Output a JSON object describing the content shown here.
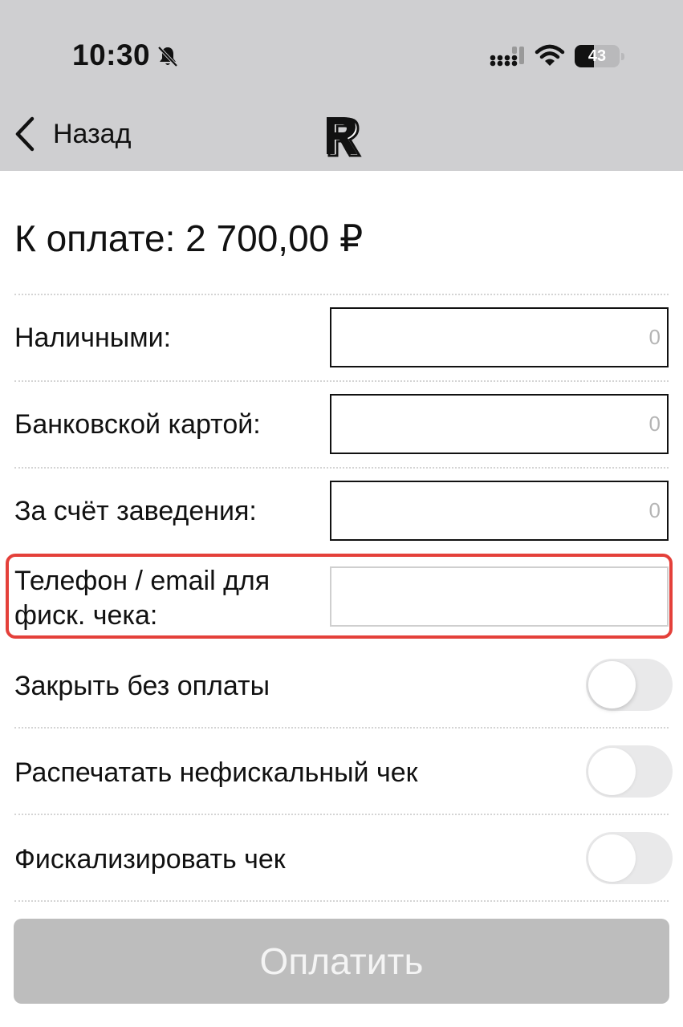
{
  "status_bar": {
    "time": "10:30",
    "battery": "43",
    "battery_level": 0.43,
    "icons": [
      "bell-muted-icon",
      "signal-icon",
      "wifi-icon",
      "battery-icon"
    ]
  },
  "nav": {
    "back_label": "Назад",
    "logo_letter": "R",
    "back_icon": "chevron-left-icon"
  },
  "payment": {
    "amount_label": "К оплате: 2 700,00 ₽",
    "cash_label": "Наличными:",
    "cash_placeholder": "0",
    "card_label": "Банковской картой:",
    "card_placeholder": "0",
    "house_label": "За счёт заведения:",
    "house_placeholder": "0",
    "phone_label_line1": "Телефон / email для",
    "phone_label_line2": "фиск. чека:",
    "phone_value": ""
  },
  "toggles": {
    "close_without_payment": "Закрыть без оплаты",
    "print_nonfiscal": "Распечатать нефискальный чек",
    "fiscalize": "Фискализировать чек"
  },
  "actions": {
    "pay_label": "Оплатить"
  },
  "colors": {
    "header_bg": "#cfcfd1",
    "highlight": "#e4403a",
    "button_disabled": "#bdbdbd",
    "toggle_off": "#e9e9ea"
  }
}
